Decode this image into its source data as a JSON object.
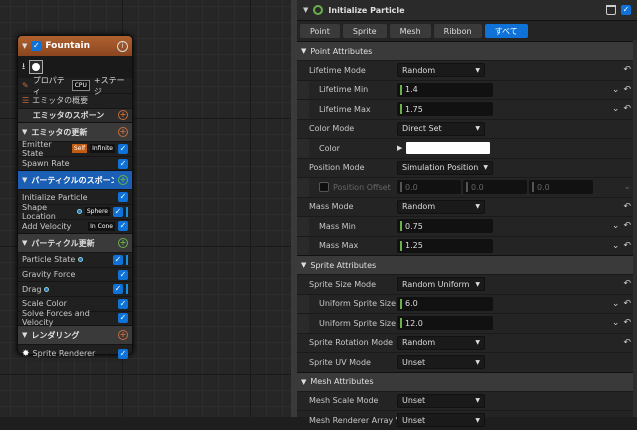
{
  "node": {
    "title": "Fountain",
    "info_glyph": "i",
    "tools": {
      "properties": "プロパティ",
      "cpu": "CPU",
      "stage": "+ステージ"
    },
    "summary": "エミッタの概要",
    "sections": [
      {
        "label": "エミッタのスポーン",
        "type": "header"
      },
      {
        "label": "エミッタの更新",
        "type": "category"
      }
    ],
    "emitter_update_modules": [
      {
        "label": "Emitter State",
        "pills": [
          "Self",
          "Infinite"
        ]
      },
      {
        "label": "Spawn Rate",
        "pills": []
      }
    ],
    "particle_spawn": "パーティクルのスポーン",
    "particle_spawn_modules": [
      {
        "label": "Initialize Particle"
      },
      {
        "label": "Shape Location",
        "pill": "Sphere"
      },
      {
        "label": "Add Velocity",
        "pill": "In Cone"
      }
    ],
    "particle_update": "パーティクル更新",
    "particle_update_modules": [
      {
        "label": "Particle State"
      },
      {
        "label": "Gravity Force"
      },
      {
        "label": "Drag"
      },
      {
        "label": "Scale Color"
      },
      {
        "label": "Solve Forces and Velocity"
      }
    ],
    "render": "レンダリング",
    "renderer": "Sprite Renderer"
  },
  "panel": {
    "title": "Initialize Particle",
    "tabs": [
      {
        "label": "Point"
      },
      {
        "label": "Sprite"
      },
      {
        "label": "Mesh"
      },
      {
        "label": "Ribbon"
      },
      {
        "label": "すべて",
        "active": true
      }
    ],
    "point_attributes": {
      "label": "Point Attributes",
      "lifetime_mode": {
        "name": "Lifetime Mode",
        "value": "Random"
      },
      "lifetime_min": {
        "name": "Lifetime Min",
        "value": "1.4"
      },
      "lifetime_max": {
        "name": "Lifetime Max",
        "value": "1.75"
      },
      "color_mode": {
        "name": "Color Mode",
        "value": "Direct Set"
      },
      "color": {
        "name": "Color",
        "swatch": "#ffffff"
      },
      "position_mode": {
        "name": "Position Mode",
        "value": "Simulation Position"
      },
      "position_offset": {
        "name": "Position Offset",
        "x": "0.0",
        "y": "0.0",
        "z": "0.0"
      },
      "mass_mode": {
        "name": "Mass Mode",
        "value": "Random"
      },
      "mass_min": {
        "name": "Mass Min",
        "value": "0.75"
      },
      "mass_max": {
        "name": "Mass Max",
        "value": "1.25"
      }
    },
    "sprite_attributes": {
      "label": "Sprite Attributes",
      "size_mode": {
        "name": "Sprite Size Mode",
        "value": "Random Uniform"
      },
      "size_min": {
        "name": "Uniform Sprite Size I",
        "value": "6.0"
      },
      "size_max": {
        "name": "Uniform Sprite Size I",
        "value": "12.0"
      },
      "rotation_mode": {
        "name": "Sprite Rotation Mode",
        "value": "Random"
      },
      "uv_mode": {
        "name": "Sprite UV Mode",
        "value": "Unset"
      }
    },
    "mesh_attributes": {
      "label": "Mesh Attributes",
      "scale_mode": {
        "name": "Mesh Scale Mode",
        "value": "Unset"
      },
      "renderer_array": {
        "name": "Mesh Renderer Array Vi",
        "value": "Unset"
      }
    }
  },
  "colors": {
    "accent": "#0e72d8",
    "node_header": "#b0622f",
    "green": "#6ab04c"
  }
}
